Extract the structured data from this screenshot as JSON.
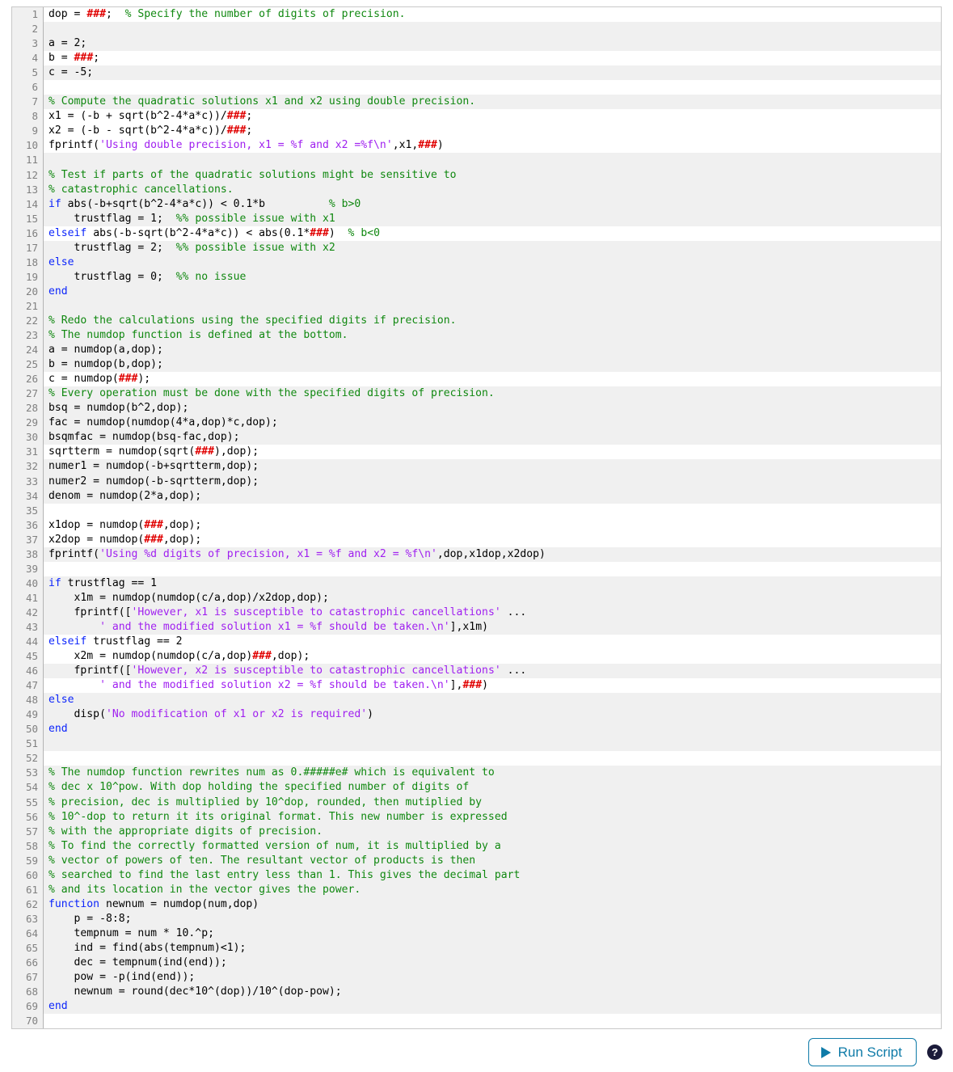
{
  "editor": {
    "language": "MATLAB",
    "total_lines": 70,
    "colors": {
      "comment": "#108810",
      "keyword": "#0b24fb",
      "string": "#a020f0",
      "error_placeholder": "#e00000",
      "plain": "#000000",
      "gutter_bg": "#f0f0f0",
      "row_shaded_bg": "#f0f0f0",
      "row_plain_bg": "#ffffff",
      "accent": "#0f7ba8"
    },
    "lines": [
      {
        "n": 1,
        "shaded": false,
        "tokens": [
          {
            "t": "plain",
            "s": "dop = "
          },
          {
            "t": "err",
            "s": "###"
          },
          {
            "t": "plain",
            "s": ";  "
          },
          {
            "t": "comment",
            "s": "% Specify the number of digits of precision."
          }
        ]
      },
      {
        "n": 2,
        "shaded": true,
        "tokens": []
      },
      {
        "n": 3,
        "shaded": true,
        "tokens": [
          {
            "t": "plain",
            "s": "a = 2;"
          }
        ]
      },
      {
        "n": 4,
        "shaded": false,
        "tokens": [
          {
            "t": "plain",
            "s": "b = "
          },
          {
            "t": "err",
            "s": "###"
          },
          {
            "t": "plain",
            "s": ";"
          }
        ]
      },
      {
        "n": 5,
        "shaded": true,
        "tokens": [
          {
            "t": "plain",
            "s": "c = -5;"
          }
        ]
      },
      {
        "n": 6,
        "shaded": false,
        "tokens": []
      },
      {
        "n": 7,
        "shaded": true,
        "tokens": [
          {
            "t": "comment",
            "s": "% Compute the quadratic solutions x1 and x2 using double precision."
          }
        ]
      },
      {
        "n": 8,
        "shaded": false,
        "tokens": [
          {
            "t": "plain",
            "s": "x1 = (-b + sqrt(b^2-4*a*c))/"
          },
          {
            "t": "err",
            "s": "###"
          },
          {
            "t": "plain",
            "s": ";"
          }
        ]
      },
      {
        "n": 9,
        "shaded": false,
        "tokens": [
          {
            "t": "plain",
            "s": "x2 = (-b - sqrt(b^2-4*a*c))/"
          },
          {
            "t": "err",
            "s": "###"
          },
          {
            "t": "plain",
            "s": ";"
          }
        ]
      },
      {
        "n": 10,
        "shaded": false,
        "tokens": [
          {
            "t": "plain",
            "s": "fprintf("
          },
          {
            "t": "string",
            "s": "'Using double precision, x1 = %f and x2 =%f\\n'"
          },
          {
            "t": "plain",
            "s": ",x1,"
          },
          {
            "t": "err",
            "s": "###"
          },
          {
            "t": "plain",
            "s": ")"
          }
        ]
      },
      {
        "n": 11,
        "shaded": true,
        "tokens": []
      },
      {
        "n": 12,
        "shaded": true,
        "tokens": [
          {
            "t": "comment",
            "s": "% Test if parts of the quadratic solutions might be sensitive to"
          }
        ]
      },
      {
        "n": 13,
        "shaded": true,
        "tokens": [
          {
            "t": "comment",
            "s": "% catastrophic cancellations."
          }
        ]
      },
      {
        "n": 14,
        "shaded": true,
        "tokens": [
          {
            "t": "keyword",
            "s": "if"
          },
          {
            "t": "plain",
            "s": " abs(-b+sqrt(b^2-4*a*c)) < 0.1*b          "
          },
          {
            "t": "comment",
            "s": "% b>0"
          }
        ]
      },
      {
        "n": 15,
        "shaded": true,
        "tokens": [
          {
            "t": "plain",
            "s": "    trustflag = 1;  "
          },
          {
            "t": "comment",
            "s": "%% possible issue with x1"
          }
        ]
      },
      {
        "n": 16,
        "shaded": false,
        "tokens": [
          {
            "t": "keyword",
            "s": "elseif"
          },
          {
            "t": "plain",
            "s": " abs(-b-sqrt(b^2-4*a*c)) < abs(0.1*"
          },
          {
            "t": "err",
            "s": "###"
          },
          {
            "t": "plain",
            "s": ")  "
          },
          {
            "t": "comment",
            "s": "% b<0"
          }
        ]
      },
      {
        "n": 17,
        "shaded": true,
        "tokens": [
          {
            "t": "plain",
            "s": "    trustflag = 2;  "
          },
          {
            "t": "comment",
            "s": "%% possible issue with x2"
          }
        ]
      },
      {
        "n": 18,
        "shaded": true,
        "tokens": [
          {
            "t": "keyword",
            "s": "else"
          }
        ]
      },
      {
        "n": 19,
        "shaded": true,
        "tokens": [
          {
            "t": "plain",
            "s": "    trustflag = 0;  "
          },
          {
            "t": "comment",
            "s": "%% no issue"
          }
        ]
      },
      {
        "n": 20,
        "shaded": true,
        "tokens": [
          {
            "t": "keyword",
            "s": "end"
          }
        ]
      },
      {
        "n": 21,
        "shaded": true,
        "tokens": []
      },
      {
        "n": 22,
        "shaded": true,
        "tokens": [
          {
            "t": "comment",
            "s": "% Redo the calculations using the specified digits if precision."
          }
        ]
      },
      {
        "n": 23,
        "shaded": true,
        "tokens": [
          {
            "t": "comment",
            "s": "% The numdop function is defined at the bottom."
          }
        ]
      },
      {
        "n": 24,
        "shaded": true,
        "tokens": [
          {
            "t": "plain",
            "s": "a = numdop(a,dop);"
          }
        ]
      },
      {
        "n": 25,
        "shaded": true,
        "tokens": [
          {
            "t": "plain",
            "s": "b = numdop(b,dop);"
          }
        ]
      },
      {
        "n": 26,
        "shaded": false,
        "tokens": [
          {
            "t": "plain",
            "s": "c = numdop("
          },
          {
            "t": "err",
            "s": "###"
          },
          {
            "t": "plain",
            "s": ");"
          }
        ]
      },
      {
        "n": 27,
        "shaded": true,
        "tokens": [
          {
            "t": "comment",
            "s": "% Every operation must be done with the specified digits of precision."
          }
        ]
      },
      {
        "n": 28,
        "shaded": true,
        "tokens": [
          {
            "t": "plain",
            "s": "bsq = numdop(b^2,dop);"
          }
        ]
      },
      {
        "n": 29,
        "shaded": true,
        "tokens": [
          {
            "t": "plain",
            "s": "fac = numdop(numdop(4*a,dop)*c,dop);"
          }
        ]
      },
      {
        "n": 30,
        "shaded": true,
        "tokens": [
          {
            "t": "plain",
            "s": "bsqmfac = numdop(bsq-fac,dop);"
          }
        ]
      },
      {
        "n": 31,
        "shaded": false,
        "tokens": [
          {
            "t": "plain",
            "s": "sqrtterm = numdop(sqrt("
          },
          {
            "t": "err",
            "s": "###"
          },
          {
            "t": "plain",
            "s": "),dop);"
          }
        ]
      },
      {
        "n": 32,
        "shaded": true,
        "tokens": [
          {
            "t": "plain",
            "s": "numer1 = numdop(-b+sqrtterm,dop);"
          }
        ]
      },
      {
        "n": 33,
        "shaded": true,
        "tokens": [
          {
            "t": "plain",
            "s": "numer2 = numdop(-b-sqrtterm,dop);"
          }
        ]
      },
      {
        "n": 34,
        "shaded": true,
        "tokens": [
          {
            "t": "plain",
            "s": "denom = numdop(2*a,dop);"
          }
        ]
      },
      {
        "n": 35,
        "shaded": false,
        "tokens": []
      },
      {
        "n": 36,
        "shaded": false,
        "tokens": [
          {
            "t": "plain",
            "s": "x1dop = numdop("
          },
          {
            "t": "err",
            "s": "###"
          },
          {
            "t": "plain",
            "s": ",dop);"
          }
        ]
      },
      {
        "n": 37,
        "shaded": false,
        "tokens": [
          {
            "t": "plain",
            "s": "x2dop = numdop("
          },
          {
            "t": "err",
            "s": "###"
          },
          {
            "t": "plain",
            "s": ",dop);"
          }
        ]
      },
      {
        "n": 38,
        "shaded": true,
        "tokens": [
          {
            "t": "plain",
            "s": "fprintf("
          },
          {
            "t": "string",
            "s": "'Using %d digits of precision, x1 = %f and x2 = %f\\n'"
          },
          {
            "t": "plain",
            "s": ",dop,x1dop,x2dop)"
          }
        ]
      },
      {
        "n": 39,
        "shaded": false,
        "tokens": []
      },
      {
        "n": 40,
        "shaded": true,
        "tokens": [
          {
            "t": "keyword",
            "s": "if"
          },
          {
            "t": "plain",
            "s": " trustflag == 1"
          }
        ]
      },
      {
        "n": 41,
        "shaded": true,
        "tokens": [
          {
            "t": "plain",
            "s": "    x1m = numdop(numdop(c/a,dop)/x2dop,dop);"
          }
        ]
      },
      {
        "n": 42,
        "shaded": true,
        "tokens": [
          {
            "t": "plain",
            "s": "    fprintf(["
          },
          {
            "t": "string",
            "s": "'However, x1 is susceptible to catastrophic cancellations'"
          },
          {
            "t": "plain",
            "s": " ..."
          }
        ]
      },
      {
        "n": 43,
        "shaded": true,
        "tokens": [
          {
            "t": "plain",
            "s": "        "
          },
          {
            "t": "string",
            "s": "' and the modified solution x1 = %f should be taken.\\n'"
          },
          {
            "t": "plain",
            "s": "],x1m)"
          }
        ]
      },
      {
        "n": 44,
        "shaded": false,
        "tokens": [
          {
            "t": "keyword",
            "s": "elseif"
          },
          {
            "t": "plain",
            "s": " trustflag == 2"
          }
        ]
      },
      {
        "n": 45,
        "shaded": false,
        "tokens": [
          {
            "t": "plain",
            "s": "    x2m = numdop(numdop(c/a,dop)"
          },
          {
            "t": "err",
            "s": "###"
          },
          {
            "t": "plain",
            "s": ",dop);"
          }
        ]
      },
      {
        "n": 46,
        "shaded": true,
        "tokens": [
          {
            "t": "plain",
            "s": "    fprintf(["
          },
          {
            "t": "string",
            "s": "'However, x2 is susceptible to catastrophic cancellations'"
          },
          {
            "t": "plain",
            "s": " ..."
          }
        ]
      },
      {
        "n": 47,
        "shaded": false,
        "tokens": [
          {
            "t": "plain",
            "s": "        "
          },
          {
            "t": "string",
            "s": "' and the modified solution x2 = %f should be taken.\\n'"
          },
          {
            "t": "plain",
            "s": "],"
          },
          {
            "t": "err",
            "s": "###"
          },
          {
            "t": "plain",
            "s": ")"
          }
        ]
      },
      {
        "n": 48,
        "shaded": true,
        "tokens": [
          {
            "t": "keyword",
            "s": "else"
          }
        ]
      },
      {
        "n": 49,
        "shaded": true,
        "tokens": [
          {
            "t": "plain",
            "s": "    disp("
          },
          {
            "t": "string",
            "s": "'No modification of x1 or x2 is required'"
          },
          {
            "t": "plain",
            "s": ")"
          }
        ]
      },
      {
        "n": 50,
        "shaded": true,
        "tokens": [
          {
            "t": "keyword",
            "s": "end"
          }
        ]
      },
      {
        "n": 51,
        "shaded": true,
        "tokens": []
      },
      {
        "n": 52,
        "shaded": false,
        "tokens": []
      },
      {
        "n": 53,
        "shaded": true,
        "tokens": [
          {
            "t": "comment",
            "s": "% The numdop function rewrites num as 0.#####e# which is equivalent to"
          }
        ]
      },
      {
        "n": 54,
        "shaded": true,
        "tokens": [
          {
            "t": "comment",
            "s": "% dec x 10^pow. With dop holding the specified number of digits of"
          }
        ]
      },
      {
        "n": 55,
        "shaded": true,
        "tokens": [
          {
            "t": "comment",
            "s": "% precision, dec is multiplied by 10^dop, rounded, then mutiplied by"
          }
        ]
      },
      {
        "n": 56,
        "shaded": true,
        "tokens": [
          {
            "t": "comment",
            "s": "% 10^-dop to return it its original format. This new number is expressed"
          }
        ]
      },
      {
        "n": 57,
        "shaded": true,
        "tokens": [
          {
            "t": "comment",
            "s": "% with the appropriate digits of precision."
          }
        ]
      },
      {
        "n": 58,
        "shaded": true,
        "tokens": [
          {
            "t": "comment",
            "s": "% To find the correctly formatted version of num, it is multiplied by a"
          }
        ]
      },
      {
        "n": 59,
        "shaded": true,
        "tokens": [
          {
            "t": "comment",
            "s": "% vector of powers of ten. The resultant vector of products is then"
          }
        ]
      },
      {
        "n": 60,
        "shaded": true,
        "tokens": [
          {
            "t": "comment",
            "s": "% searched to find the last entry less than 1. This gives the decimal part"
          }
        ]
      },
      {
        "n": 61,
        "shaded": true,
        "tokens": [
          {
            "t": "comment",
            "s": "% and its location in the vector gives the power."
          }
        ]
      },
      {
        "n": 62,
        "shaded": true,
        "tokens": [
          {
            "t": "keyword",
            "s": "function"
          },
          {
            "t": "plain",
            "s": " newnum = numdop(num,dop)"
          }
        ]
      },
      {
        "n": 63,
        "shaded": true,
        "tokens": [
          {
            "t": "plain",
            "s": "    p = -8:8;"
          }
        ]
      },
      {
        "n": 64,
        "shaded": true,
        "tokens": [
          {
            "t": "plain",
            "s": "    tempnum = num * 10.^p;"
          }
        ]
      },
      {
        "n": 65,
        "shaded": true,
        "tokens": [
          {
            "t": "plain",
            "s": "    ind = find(abs(tempnum)<1);"
          }
        ]
      },
      {
        "n": 66,
        "shaded": true,
        "tokens": [
          {
            "t": "plain",
            "s": "    dec = tempnum(ind(end));"
          }
        ]
      },
      {
        "n": 67,
        "shaded": true,
        "tokens": [
          {
            "t": "plain",
            "s": "    pow = -p(ind(end));"
          }
        ]
      },
      {
        "n": 68,
        "shaded": true,
        "tokens": [
          {
            "t": "plain",
            "s": "    newnum = round(dec*10^(dop))/10^(dop-pow);"
          }
        ]
      },
      {
        "n": 69,
        "shaded": true,
        "tokens": [
          {
            "t": "keyword",
            "s": "end"
          }
        ]
      },
      {
        "n": 70,
        "shaded": false,
        "tokens": []
      }
    ]
  },
  "footer": {
    "run_button_label": "Run Script",
    "help_icon_glyph": "?"
  }
}
